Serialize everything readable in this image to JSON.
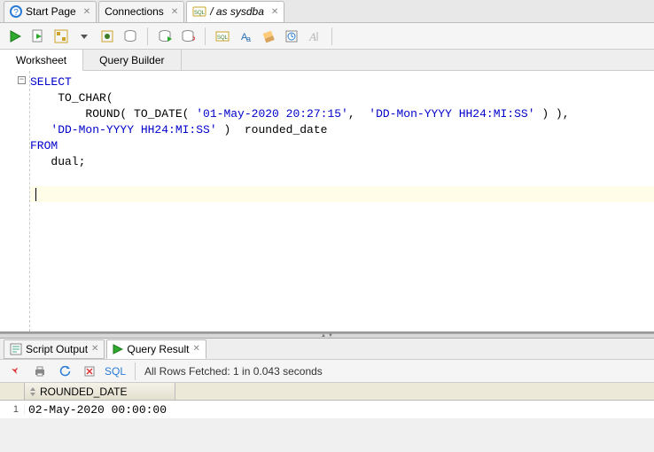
{
  "top_tabs": {
    "start_page": "Start Page",
    "connections": "Connections",
    "active": "/ as sysdba"
  },
  "sub_tabs": {
    "worksheet": "Worksheet",
    "query_builder": "Query Builder"
  },
  "sql": {
    "l1": "SELECT",
    "l2": "    TO_CHAR(",
    "l3a": "        ROUND( TO_DATE( ",
    "l3s1": "'01-May-2020 20:27:15'",
    "l3b": ",  ",
    "l3s2": "'DD-Mon-YYYY HH24:MI:SS'",
    "l3c": " ) ),",
    "l4a": "   ",
    "l4s": "'DD-Mon-YYYY HH24:MI:SS'",
    "l4b": " )  rounded_date",
    "l5": "FROM",
    "l6": "   dual;"
  },
  "result_tabs": {
    "script_output": "Script Output",
    "query_result": "Query Result"
  },
  "result_toolbar": {
    "sql_link": "SQL",
    "status": "All Rows Fetched: 1 in 0.043 seconds"
  },
  "grid": {
    "column": "ROUNDED_DATE",
    "row_num": "1",
    "value": "02-May-2020 00:00:00"
  }
}
